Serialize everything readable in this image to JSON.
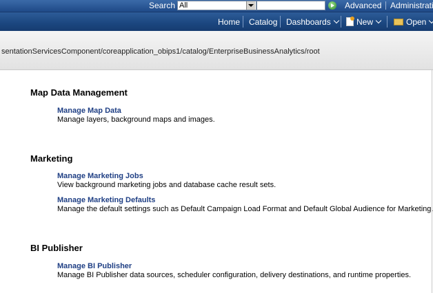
{
  "topbar": {
    "search_label": "Search",
    "search_scope": "All",
    "advanced_label": "Advanced",
    "admin_label": "Administratio"
  },
  "navbar": {
    "home": "Home",
    "catalog": "Catalog",
    "dashboards": "Dashboards",
    "new": "New",
    "open": "Open"
  },
  "path": "sentationServicesComponent/coreapplication_obips1/catalog/EnterpriseBusinessAnalytics/root",
  "sections": [
    {
      "title": "Map Data Management",
      "items": [
        {
          "link": "Manage Map Data",
          "desc": "Manage layers, background maps and images."
        }
      ]
    },
    {
      "title": "Marketing",
      "items": [
        {
          "link": "Manage Marketing Jobs",
          "desc": "View background marketing jobs and database cache result sets."
        },
        {
          "link": "Manage Marketing Defaults",
          "desc": "Manage the default settings such as Default Campaign Load Format and Default Global Audience for Marketing."
        }
      ]
    },
    {
      "title": "BI Publisher",
      "items": [
        {
          "link": "Manage BI Publisher",
          "desc": "Manage BI Publisher data sources, scheduler configuration, delivery destinations, and runtime properties."
        }
      ]
    }
  ]
}
